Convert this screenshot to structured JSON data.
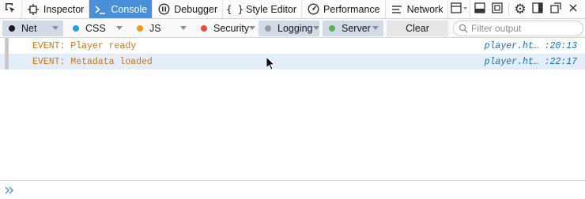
{
  "toolbox": {
    "tabs": [
      {
        "label": "Inspector",
        "icon": "inspector-icon"
      },
      {
        "label": "Console",
        "icon": "console-icon",
        "selected": true
      },
      {
        "label": "Debugger",
        "icon": "debugger-icon"
      },
      {
        "label": "Style Editor",
        "icon": "style-editor-icon"
      },
      {
        "label": "Performance",
        "icon": "performance-icon"
      },
      {
        "label": "Network",
        "icon": "network-icon"
      }
    ],
    "selected_color": "#4a90d9"
  },
  "filters": [
    {
      "label": "Net",
      "dot_color": "#1a1a1a",
      "active": true
    },
    {
      "label": "CSS",
      "dot_color": "#1fa3e0",
      "active": false
    },
    {
      "label": "JS",
      "dot_color": "#f29a12",
      "active": false
    },
    {
      "label": "Security",
      "dot_color": "#ef4b3f",
      "active": false
    },
    {
      "label": "Logging",
      "dot_color": "#9a9b9e",
      "active": true
    },
    {
      "label": "Server",
      "dot_color": "#59b15a",
      "active": true
    }
  ],
  "clear_label": "Clear",
  "search": {
    "placeholder": "Filter output",
    "value": ""
  },
  "messages": [
    {
      "text": "EVENT: Player ready",
      "location": "player.ht… :20:13",
      "color": "#d9700f"
    },
    {
      "text": "EVENT: Metadata loaded",
      "location": "player.ht… :22:17",
      "color": "#d9700f"
    }
  ],
  "input": {
    "value": ""
  }
}
